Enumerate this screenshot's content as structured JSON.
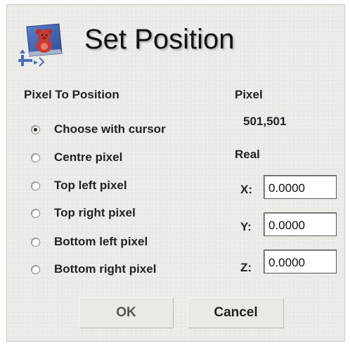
{
  "dialog": {
    "title": "Set Position",
    "title_icon": "teddy-bear-position-icon"
  },
  "pixel_to_position": {
    "heading": "Pixel To Position",
    "options": [
      {
        "label": "Choose with cursor",
        "checked": true
      },
      {
        "label": "Centre pixel",
        "checked": false
      },
      {
        "label": "Top left pixel",
        "checked": false
      },
      {
        "label": "Top right pixel",
        "checked": false
      },
      {
        "label": "Bottom left pixel",
        "checked": false
      },
      {
        "label": "Bottom right pixel",
        "checked": false
      }
    ]
  },
  "pixel": {
    "heading": "Pixel",
    "value": "501,501"
  },
  "real": {
    "heading": "Real",
    "x_label": "X:",
    "x_value": "0.0000",
    "y_label": "Y:",
    "y_value": "0.0000",
    "z_label": "Z:",
    "z_value": "0.0000"
  },
  "buttons": {
    "ok": "OK",
    "cancel": "Cancel"
  }
}
